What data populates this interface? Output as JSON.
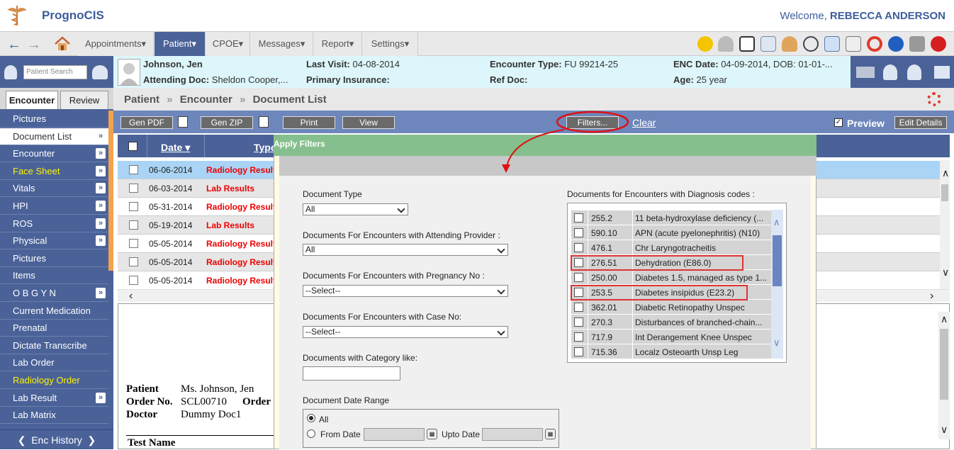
{
  "header": {
    "app_name": "PrognoCIS",
    "welcome": "Welcome,",
    "user": "REBECCA ANDERSON"
  },
  "menu": [
    "Appointments",
    "Patient",
    "CPOE",
    "Messages",
    "Report",
    "Settings"
  ],
  "patient_search_placeholder": "Patient Search",
  "patient": {
    "name": "Johnson, Jen",
    "attending": "Attending Doc:",
    "attending_val": "Sheldon Cooper,...",
    "last_visit": "Last Visit:",
    "last_visit_val": "04-08-2014",
    "insurance": "Primary Insurance:",
    "enc_type": "Encounter Type:",
    "enc_type_val": "FU 99214-25",
    "ref_doc": "Ref Doc:",
    "enc_date": "ENC Date:",
    "enc_date_val": "04-09-2014, DOB: 01-01-...",
    "age": "Age:",
    "age_val": "25 year"
  },
  "tabs": {
    "encounter": "Encounter",
    "review": "Review"
  },
  "nav": [
    "Pictures",
    "Document List",
    "Encounter",
    "Face Sheet",
    "Vitals",
    "HPI",
    "ROS",
    "Physical",
    "Pictures",
    "Items",
    "O B G Y N",
    "Current Medication",
    "Prenatal",
    "Dictate Transcribe",
    "Lab Order",
    "Radiology Order",
    "Lab Result",
    "Lab Matrix"
  ],
  "enc_history": "Enc History",
  "breadcrumb": {
    "a": "Patient",
    "b": "Encounter",
    "c": "Document List",
    "sep": "»"
  },
  "toolbar": {
    "gen_pdf": "Gen PDF",
    "gen_zip": "Gen ZIP",
    "print": "Print",
    "view": "View",
    "filters": "Filters...",
    "clear": "Clear",
    "preview": "Preview",
    "edit": "Edit Details"
  },
  "grid": {
    "date_col": "Date",
    "type_col": "Type",
    "rows": [
      {
        "date": "06-06-2014",
        "type": "Radiology Result"
      },
      {
        "date": "06-03-2014",
        "type": "Lab Results"
      },
      {
        "date": "05-31-2014",
        "type": "Radiology Result"
      },
      {
        "date": "05-19-2014",
        "type": "Lab Results"
      },
      {
        "date": "05-05-2014",
        "type": "Radiology Result"
      },
      {
        "date": "05-05-2014",
        "type": "Radiology Result"
      },
      {
        "date": "05-05-2014",
        "type": "Radiology Result"
      }
    ]
  },
  "preview_doc": {
    "patient_lbl": "Patient",
    "patient_val": "Ms. Johnson, Jen",
    "order_lbl": "Order No.",
    "order_val": "SCL00710",
    "order2": "Order",
    "doctor_lbl": "Doctor",
    "doctor_val": "Dummy Doc1",
    "test_name": "Test Name"
  },
  "filters": {
    "title": "Apply Filters",
    "doc_type": "Document Type",
    "doc_type_val": "All",
    "attending": "Documents For Encounters with Attending Provider :",
    "attending_val": "All",
    "pregnancy": "Documents For Encounters with Pregnancy No :",
    "pregnancy_val": "--Select--",
    "case": "Documents For Encounters with Case No:",
    "case_val": "--Select--",
    "category": "Documents with Category like:",
    "date_range": "Document Date Range",
    "all": "All",
    "from": "From Date",
    "upto": "Upto Date",
    "diag_title": "Documents for Encounters with Diagnosis codes :",
    "diag": [
      {
        "code": "255.2",
        "desc": "11 beta-hydroxylase deficiency (..."
      },
      {
        "code": "590.10",
        "desc": "APN (acute pyelonephritis) (N10)"
      },
      {
        "code": "476.1",
        "desc": "Chr Laryngotracheitis"
      },
      {
        "code": "276.51",
        "desc": "Dehydration (E86.0)"
      },
      {
        "code": "250.00",
        "desc": "Diabetes 1.5, managed as type 1..."
      },
      {
        "code": "253.5",
        "desc": "Diabetes insipidus (E23.2)"
      },
      {
        "code": "362.01",
        "desc": "Diabetic Retinopathy Unspec"
      },
      {
        "code": "270.3",
        "desc": "Disturbances of branched-chain..."
      },
      {
        "code": "717.9",
        "desc": "Int Derangement Knee Unspec"
      },
      {
        "code": "715.36",
        "desc": "Localz Osteoarth Unsp Leg"
      }
    ]
  },
  "colors": {
    "brand": "#4a6298",
    "toolbar": "#6d86bb",
    "dialog_title": "#85bf8d",
    "result_red": "#e00000"
  }
}
